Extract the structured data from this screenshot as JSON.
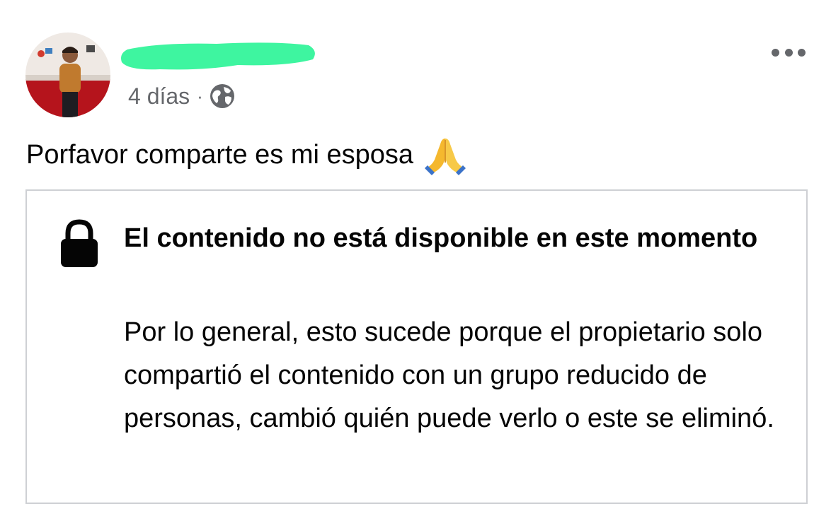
{
  "post": {
    "time": "4 días",
    "separator": "·",
    "privacy_icon": "globe-icon",
    "text": "Porfavor comparte es mi esposa",
    "emoji": "folded-hands-emoji",
    "more_icon": "more-options-icon"
  },
  "unavailable": {
    "icon": "lock-icon",
    "title": "El contenido no está disponible en este momento",
    "body": "Por lo general, esto sucede porque el propietario solo compartió el contenido con un grupo reducido de personas, cambió quién puede verlo o este se eliminó."
  },
  "colors": {
    "redaction": "#3ef5a0",
    "meta_text": "#65676b",
    "border": "#ced0d4"
  }
}
